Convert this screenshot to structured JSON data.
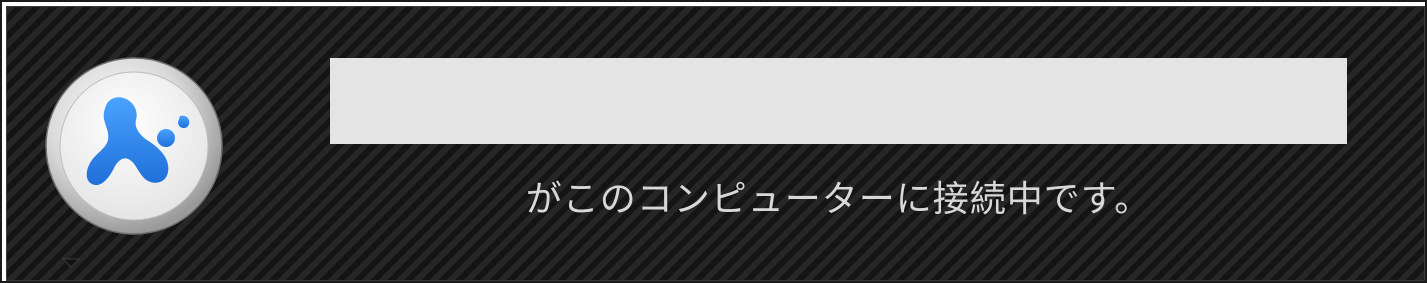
{
  "notification": {
    "app_icon": "splashtop-icon",
    "menu_icon": "chevron-down-icon",
    "user_name": "",
    "status_message": "がこのコンピューターに接続中です。"
  },
  "colors": {
    "background": "#1e1e1e",
    "name_bar": "#e4e4e4",
    "text": "#d8d8d8",
    "brand_blue": "#2b7de9"
  }
}
